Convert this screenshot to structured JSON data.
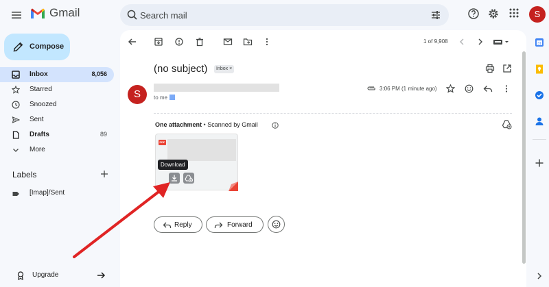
{
  "app": {
    "name": "Gmail"
  },
  "header": {
    "search_placeholder": "Search mail",
    "avatar_letter": "S"
  },
  "sidebar": {
    "compose_label": "Compose",
    "items": [
      {
        "label": "Inbox",
        "count": "8,056",
        "icon": "inbox-icon",
        "active": true,
        "bold": true
      },
      {
        "label": "Starred",
        "count": "",
        "icon": "star-icon",
        "active": false,
        "bold": false
      },
      {
        "label": "Snoozed",
        "count": "",
        "icon": "clock-icon",
        "active": false,
        "bold": false
      },
      {
        "label": "Sent",
        "count": "",
        "icon": "send-icon",
        "active": false,
        "bold": false
      },
      {
        "label": "Drafts",
        "count": "89",
        "icon": "draft-icon",
        "active": false,
        "bold": true
      },
      {
        "label": "More",
        "count": "",
        "icon": "chevron-down-icon",
        "active": false,
        "bold": false
      }
    ],
    "labels_title": "Labels",
    "labels": [
      {
        "label": "[Imap]/Sent",
        "icon": "label-icon"
      }
    ],
    "upgrade_label": "Upgrade"
  },
  "toolbar": {
    "pager_text": "1 of 9,908"
  },
  "message": {
    "subject": "(no subject)",
    "chip_label": "Inbox",
    "chip_close": "×",
    "sender_avatar_letter": "S",
    "time": "3:06 PM (1 minute ago)",
    "to_me": "to me",
    "attachment_title": "One attachment",
    "attachment_scanned": "Scanned by Gmail",
    "pdf_badge": "PDF",
    "tooltip": "Download",
    "reply_label": "Reply",
    "forward_label": "Forward"
  },
  "colors": {
    "accent": "#c2e7ff",
    "active_nav": "#d3e3fd",
    "avatar": "#c5221f",
    "annotation_arrow": "#e02424"
  }
}
